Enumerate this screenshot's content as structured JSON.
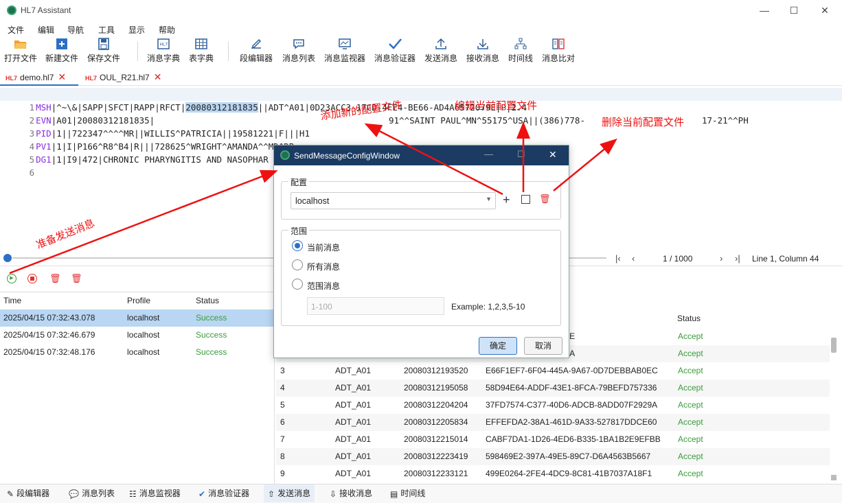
{
  "window": {
    "title": "HL7 Assistant"
  },
  "menu": [
    "文件",
    "编辑",
    "导航",
    "工具",
    "显示",
    "帮助"
  ],
  "toolbar": [
    {
      "label": "打开文件",
      "icon": "folder-open-icon"
    },
    {
      "label": "新建文件",
      "icon": "new-file-icon"
    },
    {
      "label": "保存文件",
      "icon": "save-icon"
    },
    {
      "label": "消息字典",
      "icon": "hl7-dictionary-icon"
    },
    {
      "label": "表字典",
      "icon": "table-icon"
    },
    {
      "label": "段编辑器",
      "icon": "segment-editor-icon"
    },
    {
      "label": "消息列表",
      "icon": "message-list-icon"
    },
    {
      "label": "消息监视器",
      "icon": "monitor-icon"
    },
    {
      "label": "消息验证器",
      "icon": "check-icon"
    },
    {
      "label": "发送消息",
      "icon": "upload-icon"
    },
    {
      "label": "接收消息",
      "icon": "download-icon"
    },
    {
      "label": "时间线",
      "icon": "timeline-icon"
    },
    {
      "label": "消息比对",
      "icon": "compare-icon"
    }
  ],
  "tabs": [
    {
      "badge": "HL7",
      "label": "demo.hl7"
    },
    {
      "badge": "HL7",
      "label": "OUL_R21.hl7"
    }
  ],
  "editor": {
    "lines": [
      {
        "num": "1",
        "seg": "MSH",
        "pre": "|^~\\&|SAPP|SFCT|RAPP|RFCT|",
        "sel": "20080312181835",
        "post": "||ADT^A01|0D23ACC3-17CD-4FE4-BE66-AD4A6572079E|P|2.4"
      },
      {
        "num": "2",
        "seg": "EVN",
        "pre": "|A01|20080312181835|",
        "sel": "",
        "post": ""
      },
      {
        "num": "3",
        "seg": "PID",
        "pre": "|1||722347^^^^MR||WILLIS^PATRICIA||19581221|F|||H1",
        "sel": "",
        "post": "                                       17-21^^PH"
      },
      {
        "num": "4",
        "seg": "PV1",
        "pre": "|1|I|P166^R8^B4|R|||728625^WRIGHT^AMANDA^^MD^DR",
        "sel": "",
        "post": ""
      },
      {
        "num": "5",
        "seg": "DG1",
        "pre": "|1|I9|472|CHRONIC PHARYNGITIS AND NASOPHAR",
        "sel": "",
        "post": ""
      },
      {
        "num": "6",
        "seg": "",
        "pre": "",
        "sel": "",
        "post": ""
      }
    ],
    "pid_tail": "91^^SAINT PAUL^MN^55175^USA||(386)778-"
  },
  "status": {
    "page": "1 / 1000",
    "position": "Line 1, Column 44"
  },
  "sent_table": {
    "headers": [
      "Time",
      "Profile",
      "Status"
    ],
    "rows": [
      [
        "2025/04/15 07:32:43.078",
        "localhost",
        "Success"
      ],
      [
        "2025/04/15 07:32:46.679",
        "localhost",
        "Success"
      ],
      [
        "2025/04/15 07:32:48.176",
        "localhost",
        "Success"
      ]
    ]
  },
  "msg_table": {
    "status_header": "Status",
    "rows": [
      {
        "n": "",
        "type": "",
        "time": "",
        "id": "4-BE66-AD4A6572079E",
        "status": "Accept"
      },
      {
        "n": "",
        "type": "",
        "time": "",
        "id": "4-A9A3-F175B2B459BA",
        "status": "Accept"
      },
      {
        "n": "3",
        "type": "ADT_A01",
        "time": "20080312193520",
        "id": "E66F1EF7-6F04-445A-9A67-0D7DEBBAB0EC",
        "status": "Accept"
      },
      {
        "n": "4",
        "type": "ADT_A01",
        "time": "20080312195058",
        "id": "58D94E64-ADDF-43E1-8FCA-79BEFD757336",
        "status": "Accept"
      },
      {
        "n": "5",
        "type": "ADT_A01",
        "time": "20080312204204",
        "id": "37FD7574-C377-40D6-ADCB-8ADD07F2929A",
        "status": "Accept"
      },
      {
        "n": "6",
        "type": "ADT_A01",
        "time": "20080312205834",
        "id": "EFFEFDA2-38A1-461D-9A33-527817DDCE60",
        "status": "Accept"
      },
      {
        "n": "7",
        "type": "ADT_A01",
        "time": "20080312215014",
        "id": "CABF7DA1-1D26-4ED6-B335-1BA1B2E9EFBB",
        "status": "Accept"
      },
      {
        "n": "8",
        "type": "ADT_A01",
        "time": "20080312223419",
        "id": "598469E2-397A-49E5-89C7-D6A4563B5667",
        "status": "Accept"
      },
      {
        "n": "9",
        "type": "ADT_A01",
        "time": "20080312233121",
        "id": "499E0264-2FE4-4DC9-8C81-41B7037A18F1",
        "status": "Accept"
      }
    ]
  },
  "bottom_tabs": [
    {
      "label": "段编辑器",
      "icon": "segment-editor-icon"
    },
    {
      "label": "消息列表",
      "icon": "message-list-icon"
    },
    {
      "label": "消息监视器",
      "icon": "monitor-icon"
    },
    {
      "label": "消息验证器",
      "icon": "check-icon"
    },
    {
      "label": "发送消息",
      "icon": "upload-icon"
    },
    {
      "label": "接收消息",
      "icon": "download-icon"
    },
    {
      "label": "时间线",
      "icon": "timeline-icon"
    }
  ],
  "dialog": {
    "title": "SendMessageConfigWindow",
    "config_label": "配置",
    "config_value": "localhost",
    "range_label": "范围",
    "options": [
      "当前消息",
      "所有消息",
      "范围消息"
    ],
    "range_placeholder": "1-100",
    "example": "Example: 1,2,3,5-10",
    "ok": "确定",
    "cancel": "取消"
  },
  "annotations": {
    "add": "添加新的配置文件",
    "edit": "编辑当前配置文件",
    "delete": "删除当前配置文件",
    "send": "准备发送消息"
  }
}
